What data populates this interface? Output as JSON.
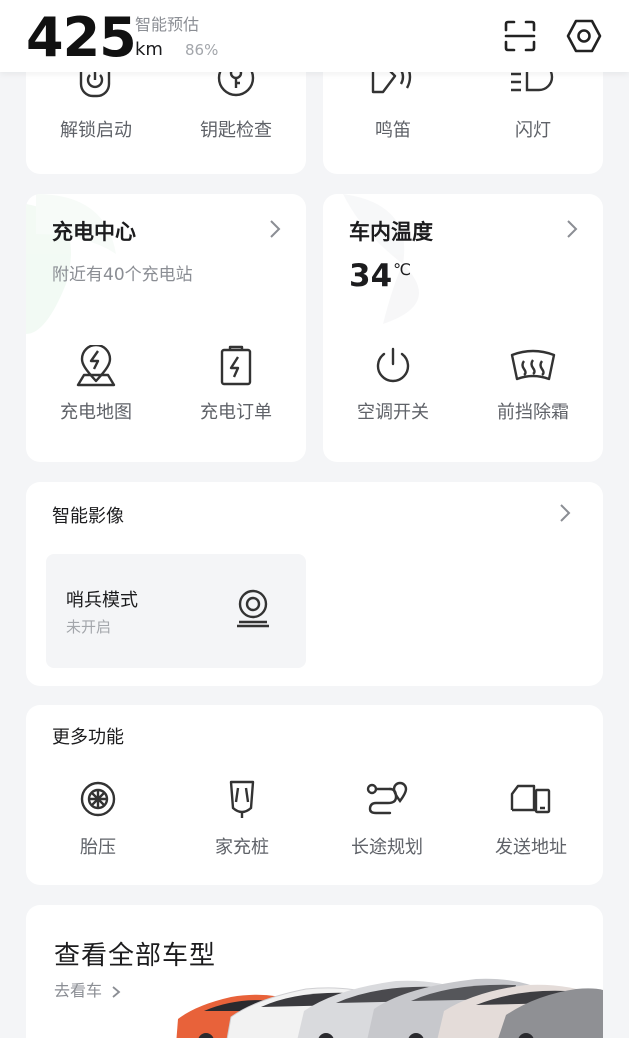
{
  "header": {
    "range_value": "425",
    "range_label": "智能预估",
    "range_unit": "km",
    "battery": "86%",
    "scan_icon": "scan-icon",
    "settings_icon": "settings-hex-icon"
  },
  "quick_controls": {
    "left": [
      {
        "label": "解锁启动",
        "icon": "unlock-start-icon"
      },
      {
        "label": "钥匙检查",
        "icon": "key-check-icon"
      }
    ],
    "right": [
      {
        "label": "鸣笛",
        "icon": "horn-icon"
      },
      {
        "label": "闪灯",
        "icon": "flash-lights-icon"
      }
    ]
  },
  "charging": {
    "title": "充电中心",
    "subtitle": "附近有40个充电站",
    "items": [
      {
        "label": "充电地图",
        "icon": "charging-map-icon"
      },
      {
        "label": "充电订单",
        "icon": "charging-order-icon"
      }
    ]
  },
  "climate": {
    "title": "车内温度",
    "temperature": "34",
    "temperature_unit": "℃",
    "items": [
      {
        "label": "空调开关",
        "icon": "power-icon"
      },
      {
        "label": "前挡除霜",
        "icon": "defrost-icon"
      }
    ]
  },
  "imaging": {
    "title": "智能影像",
    "sentry_title": "哨兵模式",
    "sentry_status": "未开启",
    "sentry_icon": "camera-icon"
  },
  "more": {
    "title": "更多功能",
    "items": [
      {
        "label": "胎压",
        "icon": "tire-icon"
      },
      {
        "label": "家充桩",
        "icon": "home-charger-icon"
      },
      {
        "label": "长途规划",
        "icon": "route-icon"
      },
      {
        "label": "发送地址",
        "icon": "send-address-icon"
      }
    ]
  },
  "models": {
    "title": "查看全部车型",
    "link": "去看车"
  },
  "colors": {
    "background": "#f4f5f7",
    "card": "#ffffff",
    "text_primary": "#1c1c1e",
    "text_secondary": "#8b8e94"
  }
}
